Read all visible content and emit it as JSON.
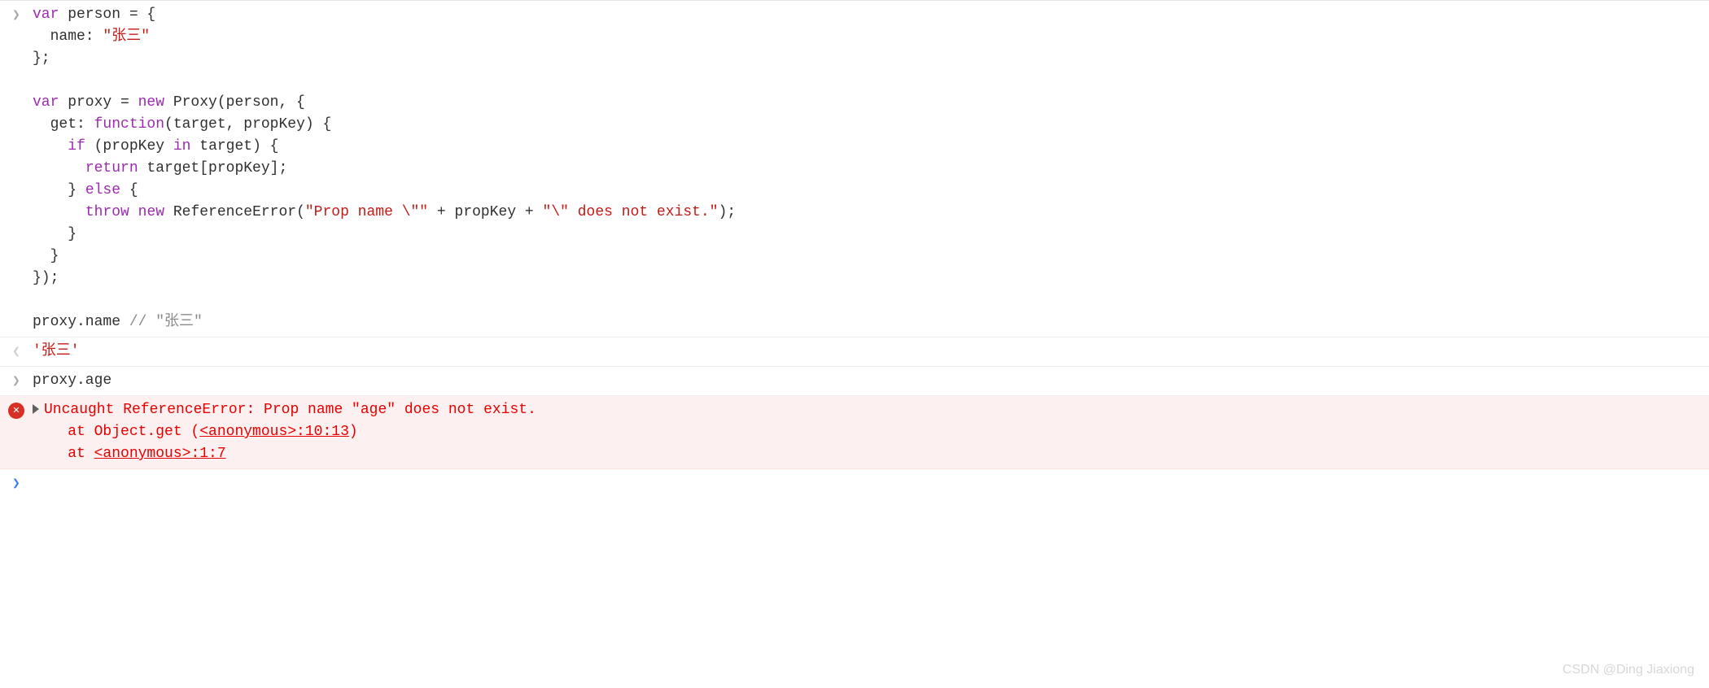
{
  "entries": [
    {
      "type": "input",
      "lines": [
        [
          {
            "t": "var",
            "c": "tok-kw"
          },
          {
            "t": " person = {"
          }
        ],
        [
          {
            "t": "  name: "
          },
          {
            "t": "\"张三\"",
            "c": "tok-str"
          }
        ],
        [
          {
            "t": "};"
          }
        ],
        [
          {
            "t": ""
          }
        ],
        [
          {
            "t": "var",
            "c": "tok-kw"
          },
          {
            "t": " proxy = "
          },
          {
            "t": "new",
            "c": "tok-kw"
          },
          {
            "t": " Proxy(person, {"
          }
        ],
        [
          {
            "t": "  get: "
          },
          {
            "t": "function",
            "c": "tok-kw"
          },
          {
            "t": "(target, propKey) {"
          }
        ],
        [
          {
            "t": "    "
          },
          {
            "t": "if",
            "c": "tok-kw"
          },
          {
            "t": " (propKey "
          },
          {
            "t": "in",
            "c": "tok-kw"
          },
          {
            "t": " target) {"
          }
        ],
        [
          {
            "t": "      "
          },
          {
            "t": "return",
            "c": "tok-kw"
          },
          {
            "t": " target[propKey];"
          }
        ],
        [
          {
            "t": "    } "
          },
          {
            "t": "else",
            "c": "tok-kw"
          },
          {
            "t": " {"
          }
        ],
        [
          {
            "t": "      "
          },
          {
            "t": "throw",
            "c": "tok-kw"
          },
          {
            "t": " "
          },
          {
            "t": "new",
            "c": "tok-kw"
          },
          {
            "t": " ReferenceError("
          },
          {
            "t": "\"Prop name \\\"\"",
            "c": "tok-str"
          },
          {
            "t": " + propKey + "
          },
          {
            "t": "\"\\\" does not exist.\"",
            "c": "tok-str"
          },
          {
            "t": ");"
          }
        ],
        [
          {
            "t": "    }"
          }
        ],
        [
          {
            "t": "  }"
          }
        ],
        [
          {
            "t": "});"
          }
        ],
        [
          {
            "t": ""
          }
        ],
        [
          {
            "t": "proxy.name "
          },
          {
            "t": "// \"张三\"",
            "c": "tok-comment"
          }
        ]
      ]
    },
    {
      "type": "output",
      "lines": [
        [
          {
            "t": "'张三'",
            "c": "tok-str"
          }
        ]
      ]
    },
    {
      "type": "input",
      "lines": [
        [
          {
            "t": "proxy.age"
          }
        ]
      ]
    },
    {
      "type": "error",
      "message": "Uncaught ReferenceError: Prop name \"age\" does not exist.",
      "stack": [
        {
          "prefix": "    at Object.get (",
          "link": "<anonymous>:10:13",
          "suffix": ")"
        },
        {
          "prefix": "    at ",
          "link": "<anonymous>:1:7",
          "suffix": ""
        }
      ]
    },
    {
      "type": "prompt"
    }
  ],
  "glyphs": {
    "input": "❯",
    "output": "❮",
    "error_x": "✕"
  },
  "watermark": "CSDN @Ding Jiaxiong"
}
